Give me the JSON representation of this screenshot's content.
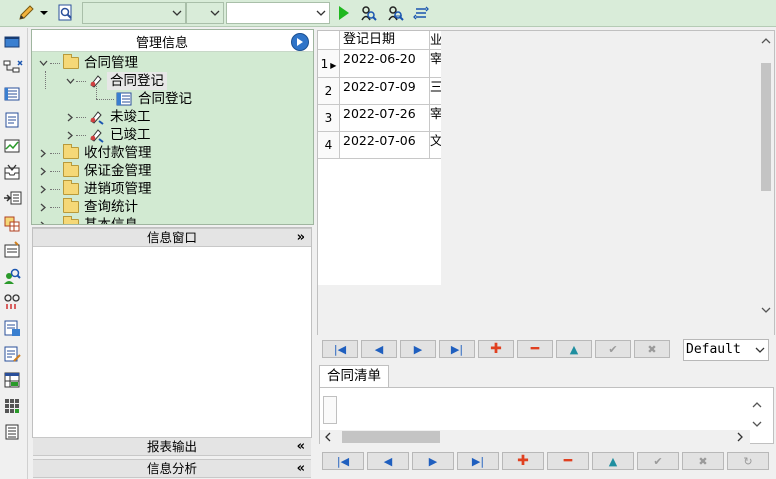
{
  "toolbar": {
    "icons": [
      "pencil-icon",
      "dropdown-icon",
      "search-doc-icon",
      "run-icon",
      "find-icon",
      "find-next-icon",
      "refresh-icon"
    ],
    "combo1_value": "",
    "combo2_value": "",
    "combo3_value": ""
  },
  "sidebar_icons": [
    "window-icon",
    "tree-icon",
    "list-icon",
    "document-icon",
    "chart-icon",
    "inbox-icon",
    "export-icon",
    "grid-icon",
    "settings-icon",
    "user-search-icon",
    "link-icon",
    "report-icon",
    "edit-icon",
    "table-icon",
    "module-grid-icon",
    "print-icon"
  ],
  "mgmt": {
    "title": "管理信息",
    "tree": [
      {
        "label": "合同管理",
        "level": 0,
        "expanded": true,
        "icon": "folder-icon"
      },
      {
        "label": "合同登记",
        "level": 1,
        "expanded": true,
        "icon": "contract-icon",
        "selected": true
      },
      {
        "label": "合同登记",
        "level": 2,
        "icon": "form-icon"
      },
      {
        "label": "未竣工",
        "level": 1,
        "expanded": false,
        "icon": "contract-icon"
      },
      {
        "label": "已竣工",
        "level": 1,
        "expanded": false,
        "icon": "contract-icon"
      },
      {
        "label": "收付款管理",
        "level": 0,
        "expanded": false,
        "icon": "folder-icon"
      },
      {
        "label": "保证金管理",
        "level": 0,
        "expanded": false,
        "icon": "folder-icon"
      },
      {
        "label": "进销项管理",
        "level": 0,
        "expanded": false,
        "icon": "folder-icon"
      },
      {
        "label": "查询统计",
        "level": 0,
        "expanded": false,
        "icon": "folder-icon"
      },
      {
        "label": "基本信息",
        "level": 0,
        "expanded": false,
        "icon": "folder-icon"
      }
    ]
  },
  "panels": {
    "info_window": "信息窗口",
    "report_output": "报表输出",
    "info_analysis": "信息分析"
  },
  "grid": {
    "column_header": "登记日期",
    "second_col_header": "业",
    "rows": [
      {
        "index": "1",
        "date": "2022-06-20",
        "col2": "宰"
      },
      {
        "index": "2",
        "date": "2022-07-09",
        "col2": "三"
      },
      {
        "index": "3",
        "date": "2022-07-26",
        "col2": "宰"
      },
      {
        "index": "4",
        "date": "2022-07-06",
        "col2": "文"
      }
    ]
  },
  "navigator": {
    "layout_select": "Default",
    "buttons": [
      "first",
      "prior",
      "next",
      "last",
      "insert",
      "delete",
      "edit",
      "post",
      "cancel"
    ]
  },
  "detail": {
    "tab_label": "合同清单",
    "buttons": [
      "first",
      "prior",
      "next",
      "last",
      "insert",
      "delete",
      "edit",
      "post",
      "cancel",
      "refresh"
    ]
  }
}
